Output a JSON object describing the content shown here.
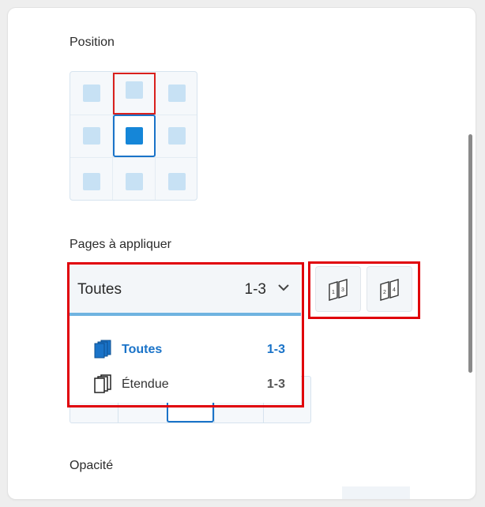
{
  "position": {
    "label": "Position",
    "selected_cell": "middle-center",
    "highlighted_cell": "top-center"
  },
  "pages": {
    "label": "Pages à appliquer",
    "select": {
      "value": "Toutes",
      "range": "1-3"
    },
    "options": [
      {
        "label": "Toutes",
        "range": "1-3",
        "icon": "pages-stack-icon",
        "selected": true
      },
      {
        "label": "Étendue",
        "range": "1-3",
        "icon": "pages-range-icon",
        "selected": false
      }
    ],
    "buttons": [
      {
        "icon": "odd-pages-icon",
        "glyph": "1 3"
      },
      {
        "icon": "even-pages-icon",
        "glyph": "2 4"
      }
    ]
  },
  "opacity": {
    "label": "Opacité"
  },
  "colors": {
    "accent": "#1a73c8",
    "highlight_red": "#e0000a",
    "cell_light": "#c7e1f4"
  }
}
